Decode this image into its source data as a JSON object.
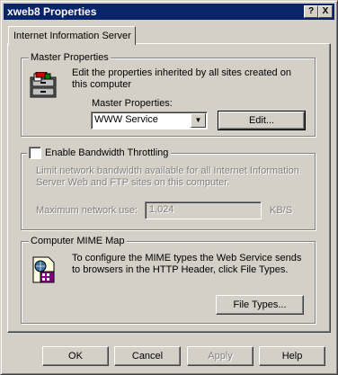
{
  "window": {
    "title": "xweb8 Properties",
    "help_btn": "?",
    "close_btn": "X"
  },
  "tabs": [
    {
      "label": "Internet Information Server"
    }
  ],
  "master": {
    "group_title": "Master Properties",
    "description": "Edit the properties inherited by all sites created on this computer",
    "label": "Master Properties:",
    "selected": "WWW Service",
    "edit_button": "Edit..."
  },
  "bandwidth": {
    "checkbox_label": "Enable Bandwidth Throttling",
    "description": "Limit network bandwidth available for all Internet Information Server Web and FTP sites on this computer.",
    "max_label": "Maximum network use:",
    "value": "1,024",
    "unit": "KB/S"
  },
  "mime": {
    "group_title": "Computer MIME Map",
    "description": "To configure the MIME types the Web Service sends to browsers in the HTTP Header, click File Types.",
    "file_types_button": "File Types..."
  },
  "footer": {
    "ok": "OK",
    "cancel": "Cancel",
    "apply": "Apply",
    "help": "Help"
  }
}
